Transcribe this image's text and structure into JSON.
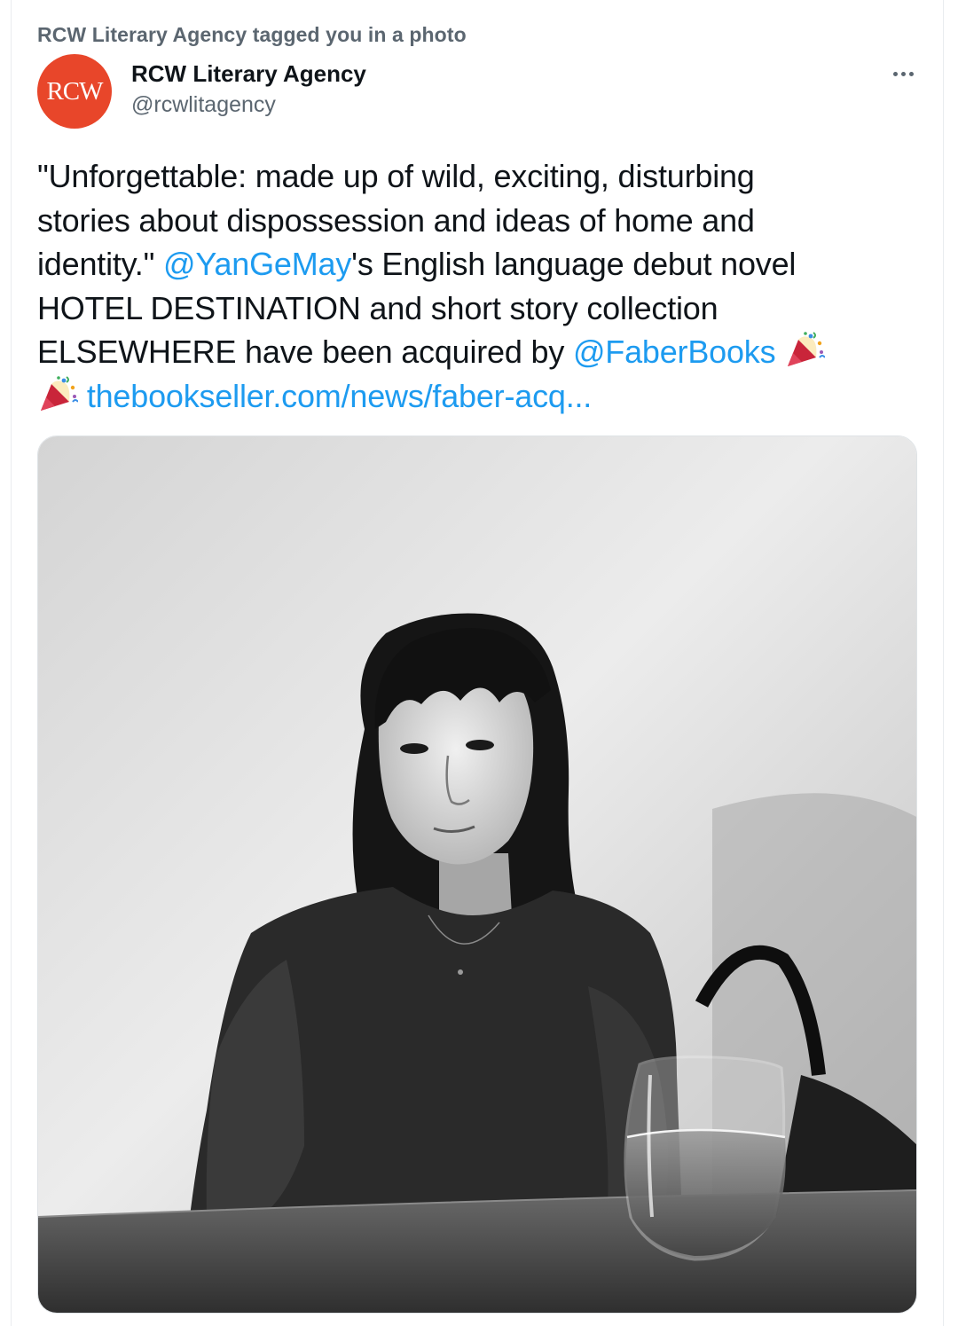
{
  "tag_line": "RCW Literary Agency tagged you in a photo",
  "author": {
    "name": "RCW Literary Agency",
    "handle": "@rcwlitagency",
    "avatar_text": "RCW",
    "avatar_color": "#e8462a"
  },
  "tweet": {
    "line1": "\"Unforgettable: made up of wild, exciting, disturbing",
    "line2": "stories about dispossession and ideas of home and",
    "line3_pre": "identity.\" ",
    "mention1": "@YanGeMay",
    "line3_post": "'s English language debut novel",
    "line4": "HOTEL DESTINATION and short story collection",
    "line5_pre": "ELSEWHERE have been acquired by ",
    "mention2": "@FaberBooks",
    "link": "thebookseller.com/news/faber-acq..."
  },
  "icons": {
    "more": "more-horizontal-icon",
    "party": "party-popper-icon"
  },
  "colors": {
    "link": "#1d9bf0",
    "secondary_text": "#5b6670",
    "primary_text": "#0f1419"
  },
  "photo": {
    "description_icon": "photo-image"
  }
}
